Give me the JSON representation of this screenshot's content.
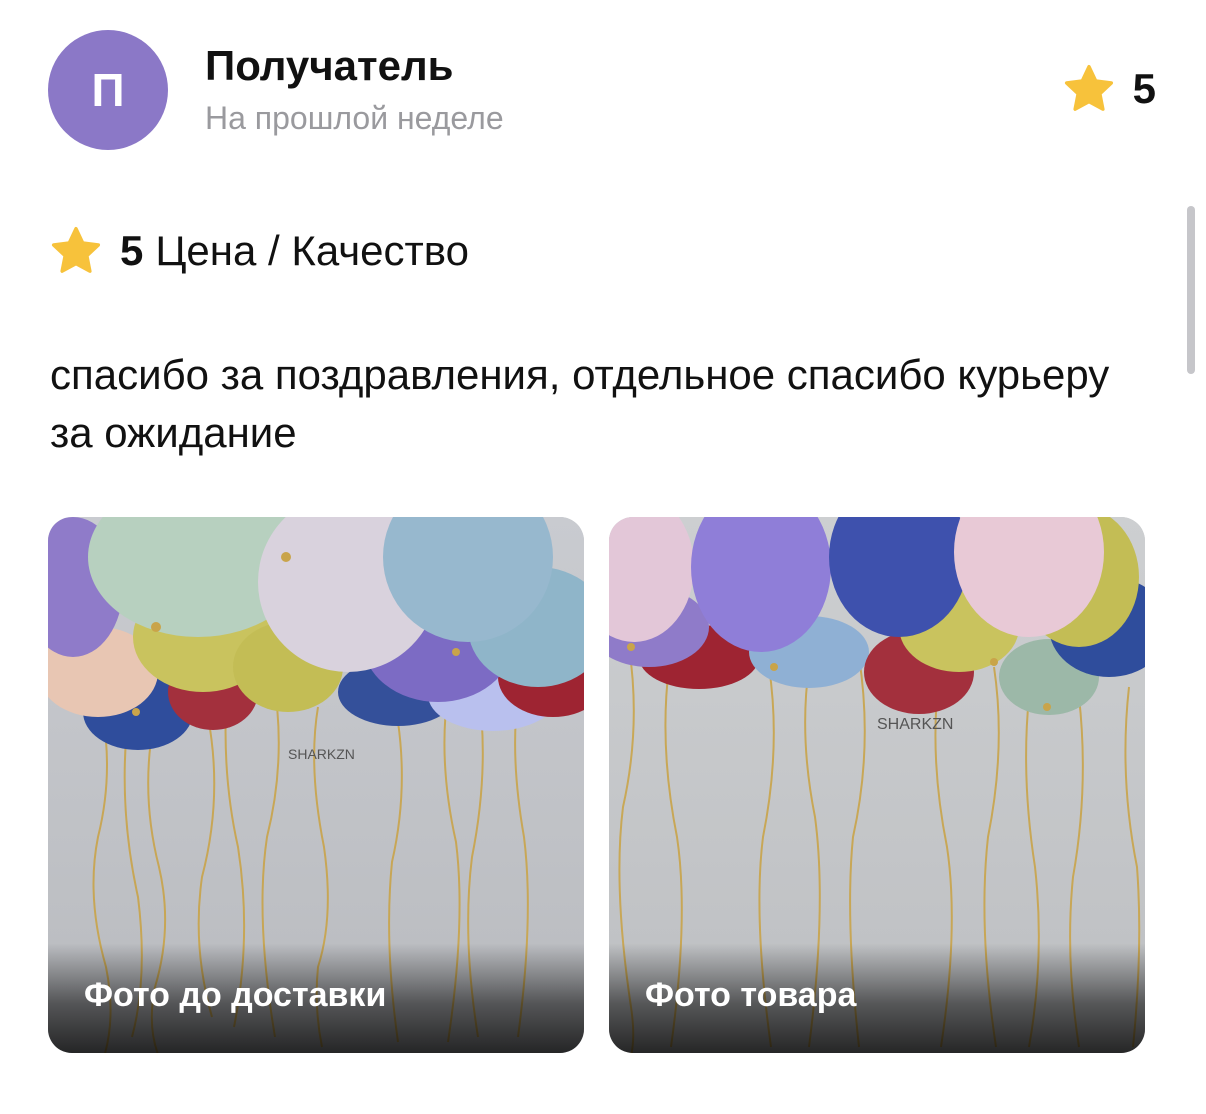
{
  "review": {
    "author_initial": "П",
    "author_name": "Получатель",
    "date": "На прошлой неделе",
    "rating": "5",
    "criteria": {
      "value": "5",
      "name": "Цена / Качество"
    },
    "text": "спасибо за поздравления, отдельное спасибо курьеру за ожидание"
  },
  "photos": [
    {
      "caption": "Фото до доставки",
      "watermark": "SHARKZN"
    },
    {
      "caption": "Фото товара",
      "watermark": "SHARKZN"
    }
  ],
  "colors": {
    "avatar": "#8b78c7",
    "star": "#f7c23b",
    "secondary_text": "#9a9a9e"
  },
  "icons": {
    "rating": "star-icon",
    "criteria": "star-icon"
  }
}
